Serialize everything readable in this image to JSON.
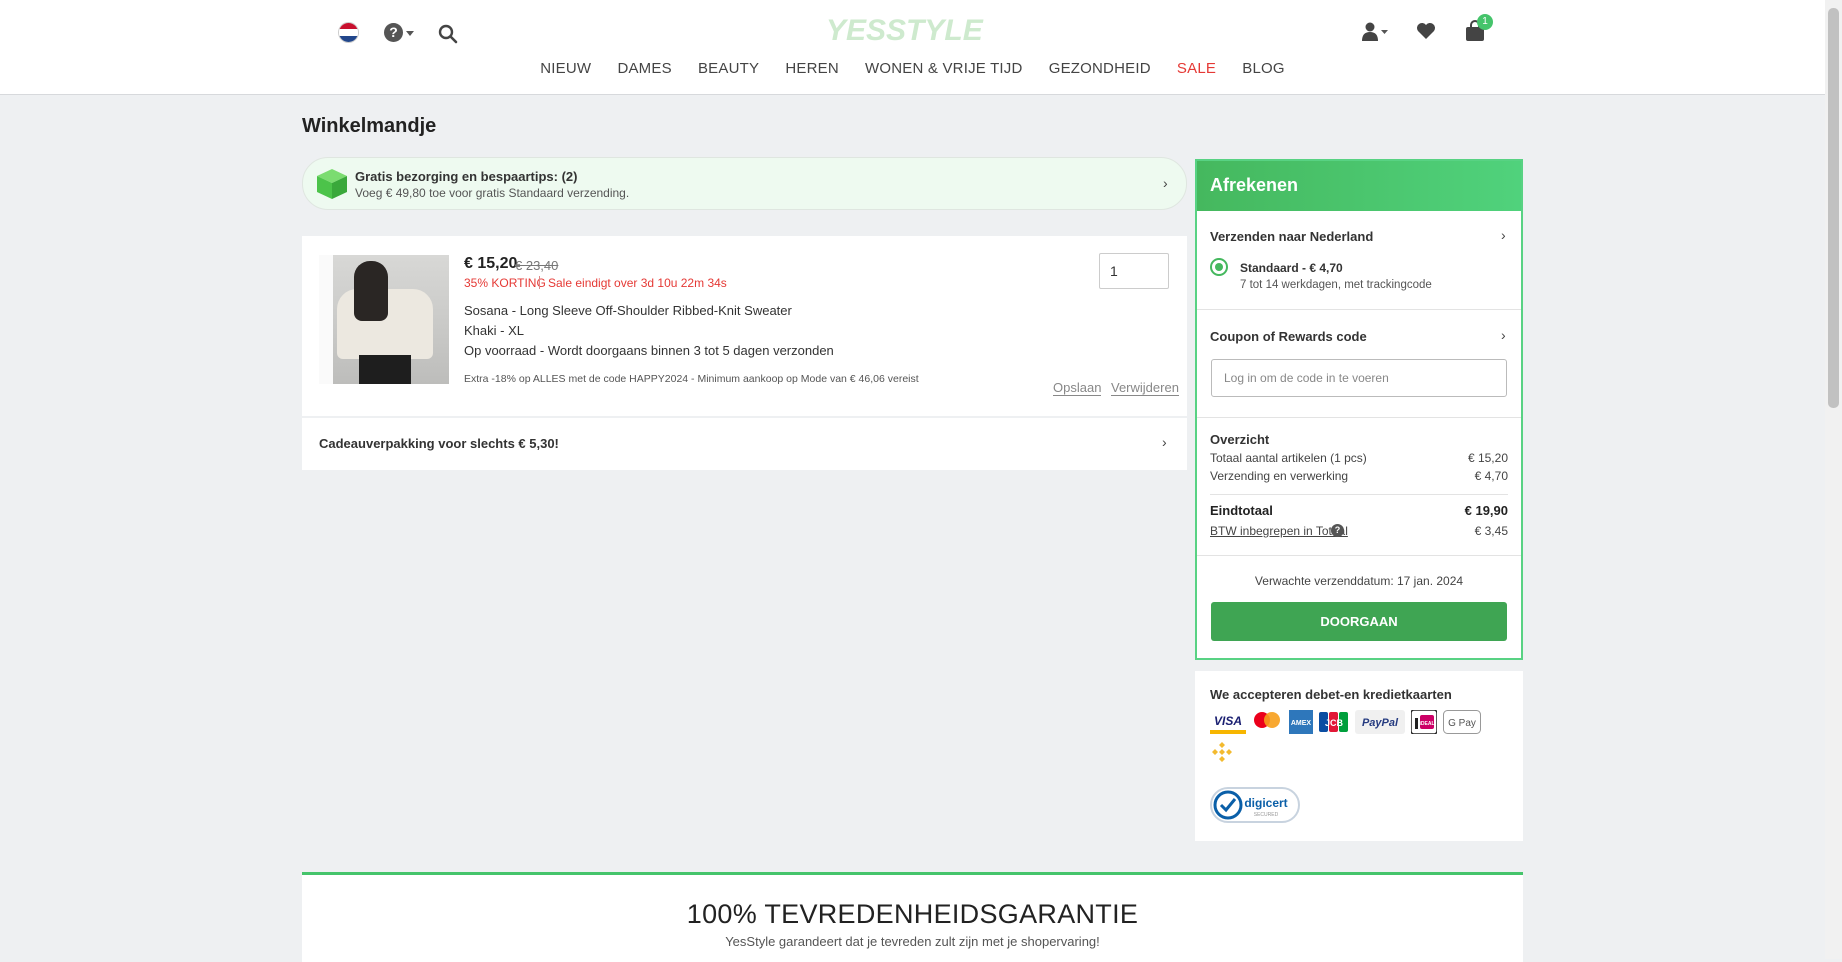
{
  "header": {
    "nav": [
      "NIEUW",
      "DAMES",
      "BEAUTY",
      "HEREN",
      "WONEN & VRIJE TIJD",
      "GEZONDHEID",
      "SALE",
      "BLOG"
    ],
    "cart_count": "1",
    "help_symbol": "?"
  },
  "page_title": "Winkelmandje",
  "promo": {
    "title": "Gratis bezorging en bespaartips: (2)",
    "subtitle": "Voeg € 49,80 toe voor gratis Standaard verzending."
  },
  "item": {
    "price": "€ 15,20",
    "old_price": "€ 23,40",
    "discount": "35% KORTING",
    "sale_end": "Sale eindigt over 3d 10u 22m 34s",
    "name": "Sosana - Long Sleeve Off-Shoulder Ribbed-Knit Sweater",
    "variant": "Khaki - XL",
    "stock": "Op voorraad - Wordt doorgaans binnen 3 tot 5 dagen verzonden",
    "extra": "Extra -18% op ALLES met de code HAPPY2024 - Minimum aankoop op Mode van € 46,06 vereist",
    "quantity": "1",
    "save_label": "Opslaan",
    "remove_label": "Verwijderen"
  },
  "gift": {
    "label": "Cadeauverpakking voor slechts € 5,30!"
  },
  "checkout": {
    "title": "Afrekenen",
    "ship_to": "Verzenden naar Nederland",
    "standard": "Standaard - € 4,70",
    "standard_days": "7 tot 14 werkdagen, met trackingcode",
    "coupon_label": "Coupon of Rewards code",
    "coupon_placeholder": "Log in om de code in te voeren",
    "overview_title": "Overzicht",
    "items_label": "Totaal aantal artikelen (1 pcs)",
    "items_value": "€ 15,20",
    "shipping_label": "Verzending en verwerking",
    "shipping_value": "€ 4,70",
    "total_label": "Eindtotaal",
    "total_value": "€ 19,90",
    "vat_label": "BTW inbegrepen in Totaal",
    "vat_value": "€ 3,45",
    "eta": "Verwachte verzenddatum: 17 jan. 2024",
    "button": "DOORGAAN"
  },
  "payment": {
    "title": "We accepteren debet-en kredietkaarten",
    "cards": [
      "VISA",
      "mastercard",
      "AMEX",
      "JCB",
      "PayPal",
      "iDEAL",
      "G Pay",
      "Binance Pay"
    ],
    "seal": "digicert",
    "seal_sub": "SECURED"
  },
  "guarantee": {
    "title": "100% TEVREDENHEIDSGARANTIE",
    "subtitle": "YesStyle garandeert dat je tevreden zult zijn met je shopervaring!"
  },
  "colors": {
    "accent": "#45b85e",
    "sale": "#e53935",
    "background": "#eef0f2"
  }
}
